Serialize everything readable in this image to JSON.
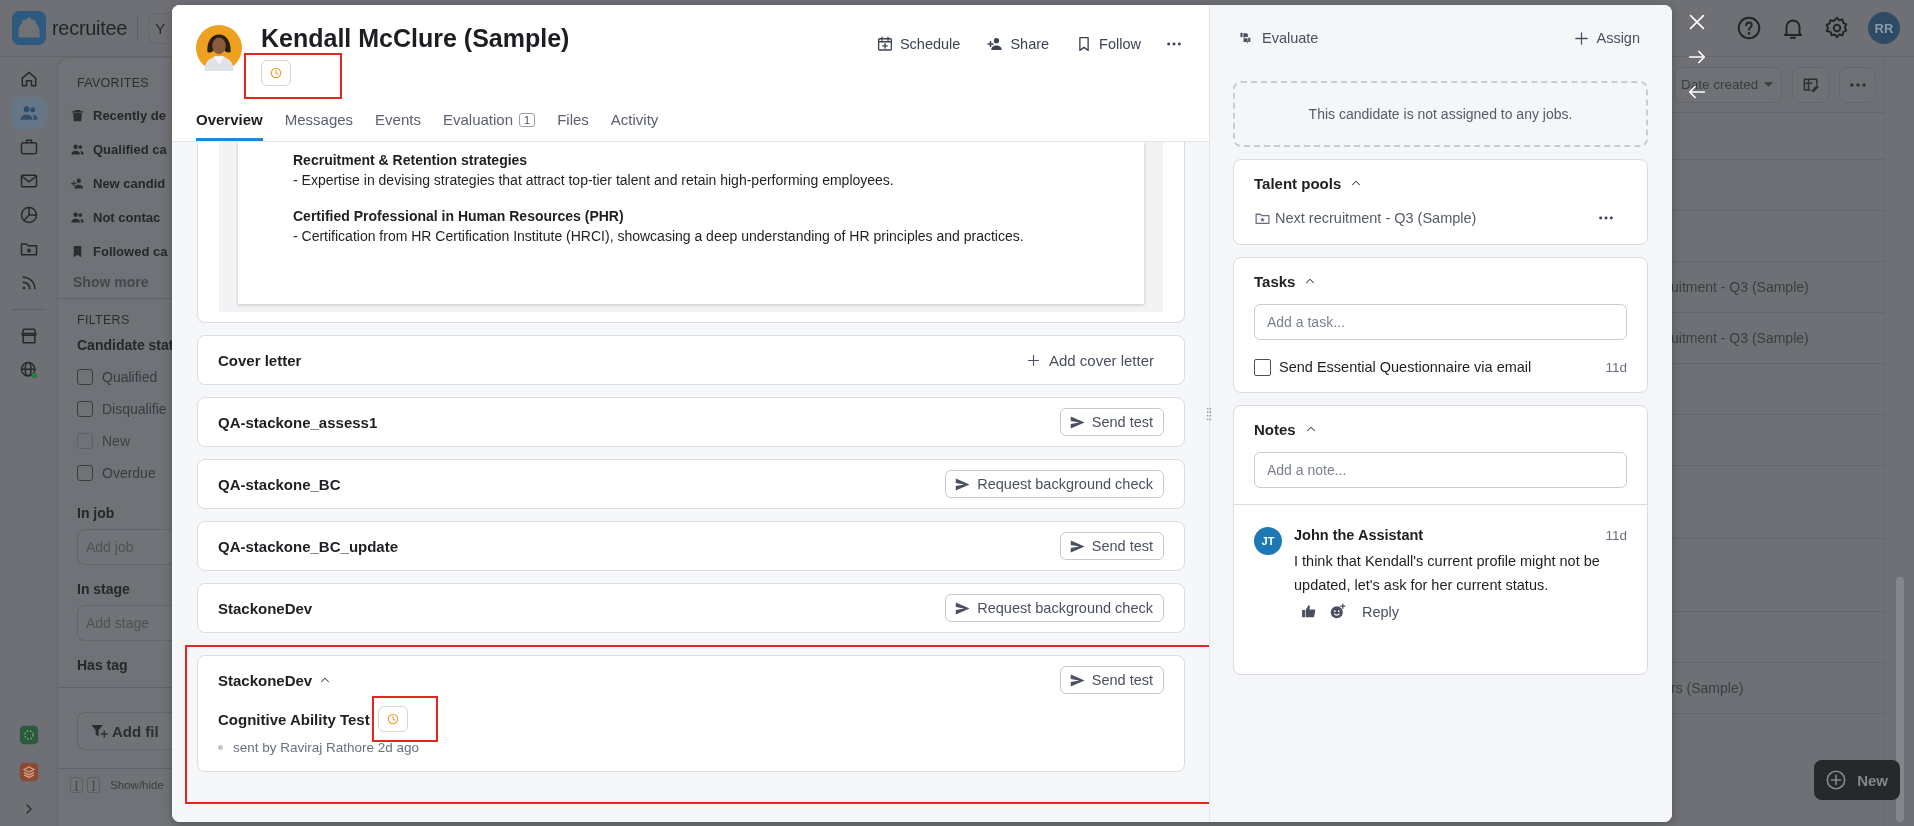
{
  "app_bar": {
    "logo": "recruitee",
    "workspace": "Y",
    "avatar": "RR"
  },
  "nav": [
    {
      "kind": "home",
      "selected": false
    },
    {
      "kind": "candidates",
      "selected": true
    },
    {
      "kind": "jobs",
      "selected": false
    },
    {
      "kind": "mail",
      "selected": false
    },
    {
      "kind": "reports",
      "selected": false
    },
    {
      "kind": "pools",
      "selected": false
    },
    {
      "kind": "feed",
      "selected": false
    },
    {
      "kind": "store",
      "selected": false
    },
    {
      "kind": "careers",
      "selected": false
    }
  ],
  "nav_apps": [
    {
      "kind": "sparkle"
    },
    {
      "kind": "layers"
    }
  ],
  "sidebar": {
    "favorites_title": "FAVORITES",
    "favorites": [
      {
        "kind": "trash",
        "label": "Recently de"
      },
      {
        "kind": "people",
        "label": "Qualified ca"
      },
      {
        "kind": "person-plus",
        "label": "New candid"
      },
      {
        "kind": "people",
        "label": "Not contac"
      },
      {
        "kind": "bookmark",
        "label": "Followed ca"
      }
    ],
    "show_more": "Show more",
    "filters_title": "FILTERS",
    "status_title": "Candidate stat",
    "statuses": [
      {
        "label": "Qualified",
        "checked": false,
        "disabled": false
      },
      {
        "label": "Disqualifie",
        "checked": false,
        "disabled": false
      },
      {
        "label": "New",
        "checked": false,
        "disabled": true
      },
      {
        "label": "Overdue",
        "checked": false,
        "disabled": false
      }
    ],
    "job_title": "In job",
    "job_placeholder": "Add job",
    "stage_title": "In stage",
    "stage_placeholder": "Add stage",
    "tag_title": "Has tag",
    "add_filter": "Add fil",
    "footer_keys": [
      "[",
      "]"
    ],
    "footer_label": "Show/hide"
  },
  "list_toolbar": {
    "sort": "Date created"
  },
  "list_rows": [
    {
      "tall": false
    },
    {
      "tall": false
    },
    {
      "tall": false
    },
    {
      "tall": false,
      "text": "uitment - Q3 (Sample)"
    },
    {
      "tall": false,
      "text": "uitment - Q3 (Sample)"
    },
    {
      "tall": false
    },
    {
      "tall": false
    },
    {
      "tall": true
    },
    {
      "tall": true
    },
    {
      "tall": false
    },
    {
      "tall": false,
      "text": "rs (Sample)"
    },
    {
      "tall": false
    }
  ],
  "new_button": "New",
  "candidate": {
    "name": "Kendall McClure (Sample)",
    "status_highlighted": true,
    "actions": [
      {
        "kind": "schedule",
        "label": "Schedule"
      },
      {
        "kind": "share",
        "label": "Share"
      },
      {
        "kind": "follow",
        "label": "Follow"
      },
      {
        "kind": "more"
      }
    ]
  },
  "tabs": [
    {
      "label": "Overview",
      "selected": true
    },
    {
      "label": "Messages",
      "selected": false
    },
    {
      "label": "Events",
      "selected": false
    },
    {
      "label": "Evaluation",
      "count": "1",
      "selected": false
    },
    {
      "label": "Files",
      "selected": false
    },
    {
      "label": "Activity",
      "selected": false
    }
  ],
  "resume": [
    {
      "title": "Recruitment & Retention strategies",
      "text": "- Expertise in devising strategies that attract top-tier talent and retain high-performing employees."
    },
    {
      "title": "Certified Professional in Human Resources (PHR)",
      "text": "- Certification from HR Certification Institute (HRCI), showcasing a deep understanding of HR principles and practices."
    }
  ],
  "sections": [
    {
      "title": "Cover letter",
      "expanded": false,
      "highlighted": false,
      "action": {
        "kind": "add",
        "label": "Add cover letter"
      }
    },
    {
      "title": "QA-stackone_assess1",
      "expanded": false,
      "highlighted": false,
      "action": {
        "kind": "send",
        "label": "Send test"
      }
    },
    {
      "title": "QA-stackone_BC",
      "expanded": false,
      "highlighted": false,
      "action": {
        "kind": "send",
        "label": "Request background check"
      }
    },
    {
      "title": "QA-stackone_BC_update",
      "expanded": false,
      "highlighted": false,
      "action": {
        "kind": "send",
        "label": "Send test"
      }
    },
    {
      "title": "StackoneDev",
      "expanded": false,
      "highlighted": false,
      "action": {
        "kind": "send",
        "label": "Request background check"
      }
    },
    {
      "title": "StackoneDev",
      "expanded": true,
      "highlighted": true,
      "action": {
        "kind": "send",
        "label": "Send test"
      },
      "items": [
        {
          "name": "Cognitive Ability Test",
          "status_highlighted": true,
          "meta": "sent by Raviraj Rathore 2d ago"
        }
      ]
    }
  ],
  "side_panel": {
    "evaluate": "Evaluate",
    "assign": "Assign",
    "jobs_empty": "This candidate is not assigned to any jobs.",
    "talent_pools": {
      "title": "Talent pools",
      "expanded": true,
      "items": [
        {
          "label": "Next recruitment - Q3 (Sample)"
        }
      ]
    },
    "tasks": {
      "title": "Tasks",
      "expanded": true,
      "placeholder": "Add a task...",
      "items": [
        {
          "label": "Send Essential Questionnaire via email",
          "age": "11d",
          "checked": false
        }
      ]
    },
    "notes": {
      "title": "Notes",
      "expanded": true,
      "placeholder": "Add a note...",
      "items": [
        {
          "initials": "JT",
          "author": "John the Assistant",
          "age": "11d",
          "text": "I think that Kendall's current profile might not be updated, let's ask for her current status.",
          "reply": "Reply"
        }
      ]
    }
  }
}
